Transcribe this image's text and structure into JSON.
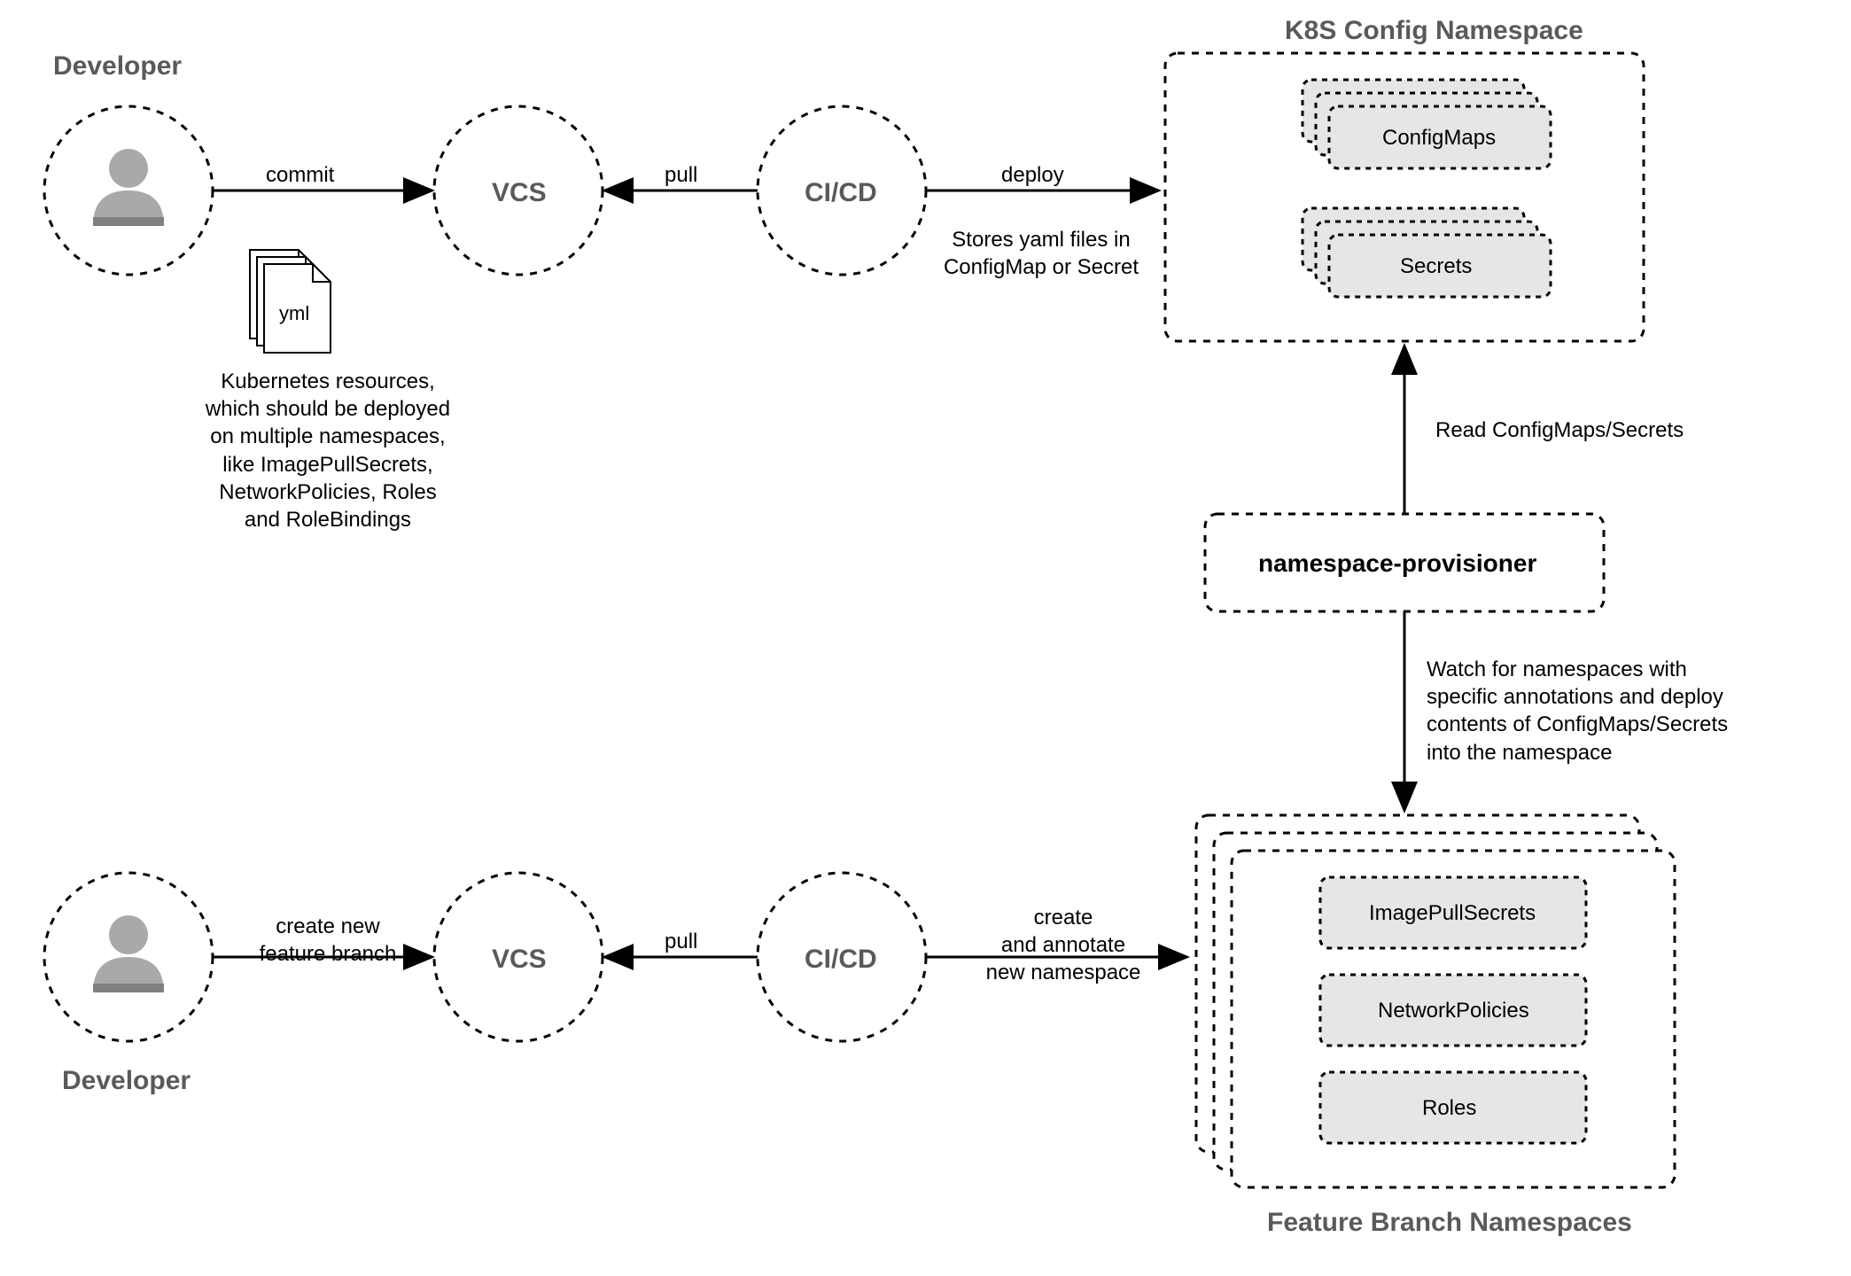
{
  "actors": {
    "topDeveloper": "Developer",
    "bottomDeveloper": "Developer"
  },
  "nodes": {
    "vcs_top": "VCS",
    "cicd_top": "CI/CD",
    "vcs_bottom": "VCS",
    "cicd_bottom": "CI/CD",
    "provisioner": "namespace-provisioner"
  },
  "arrows": {
    "commit": "commit",
    "pull_top": "pull",
    "deploy": "deploy",
    "deploy_note": "Stores yaml files in\nConfigMap or Secret",
    "read_configmaps": "Read ConfigMaps/Secrets",
    "watch_namespaces": "Watch for namespaces with\nspecific annotations and deploy\ncontents of ConfigMaps/Secrets\ninto the namespace",
    "create_branch": "create new\nfeature branch",
    "pull_bottom": "pull",
    "create_namespace": "create\nand annotate\nnew namespace"
  },
  "k8s_config": {
    "title": "K8S Config Namespace",
    "configmaps": "ConfigMaps",
    "secrets": "Secrets"
  },
  "feature_ns": {
    "title": "Feature Branch Namespaces",
    "imagepullsecrets": "ImagePullSecrets",
    "networkpolicies": "NetworkPolicies",
    "roles": "Roles"
  },
  "file": {
    "yml": "yml",
    "description": "Kubernetes resources,\nwhich should be deployed\non multiple namespaces,\nlike ImagePullSecrets,\nNetworkPolicies, Roles\nand RoleBindings"
  }
}
